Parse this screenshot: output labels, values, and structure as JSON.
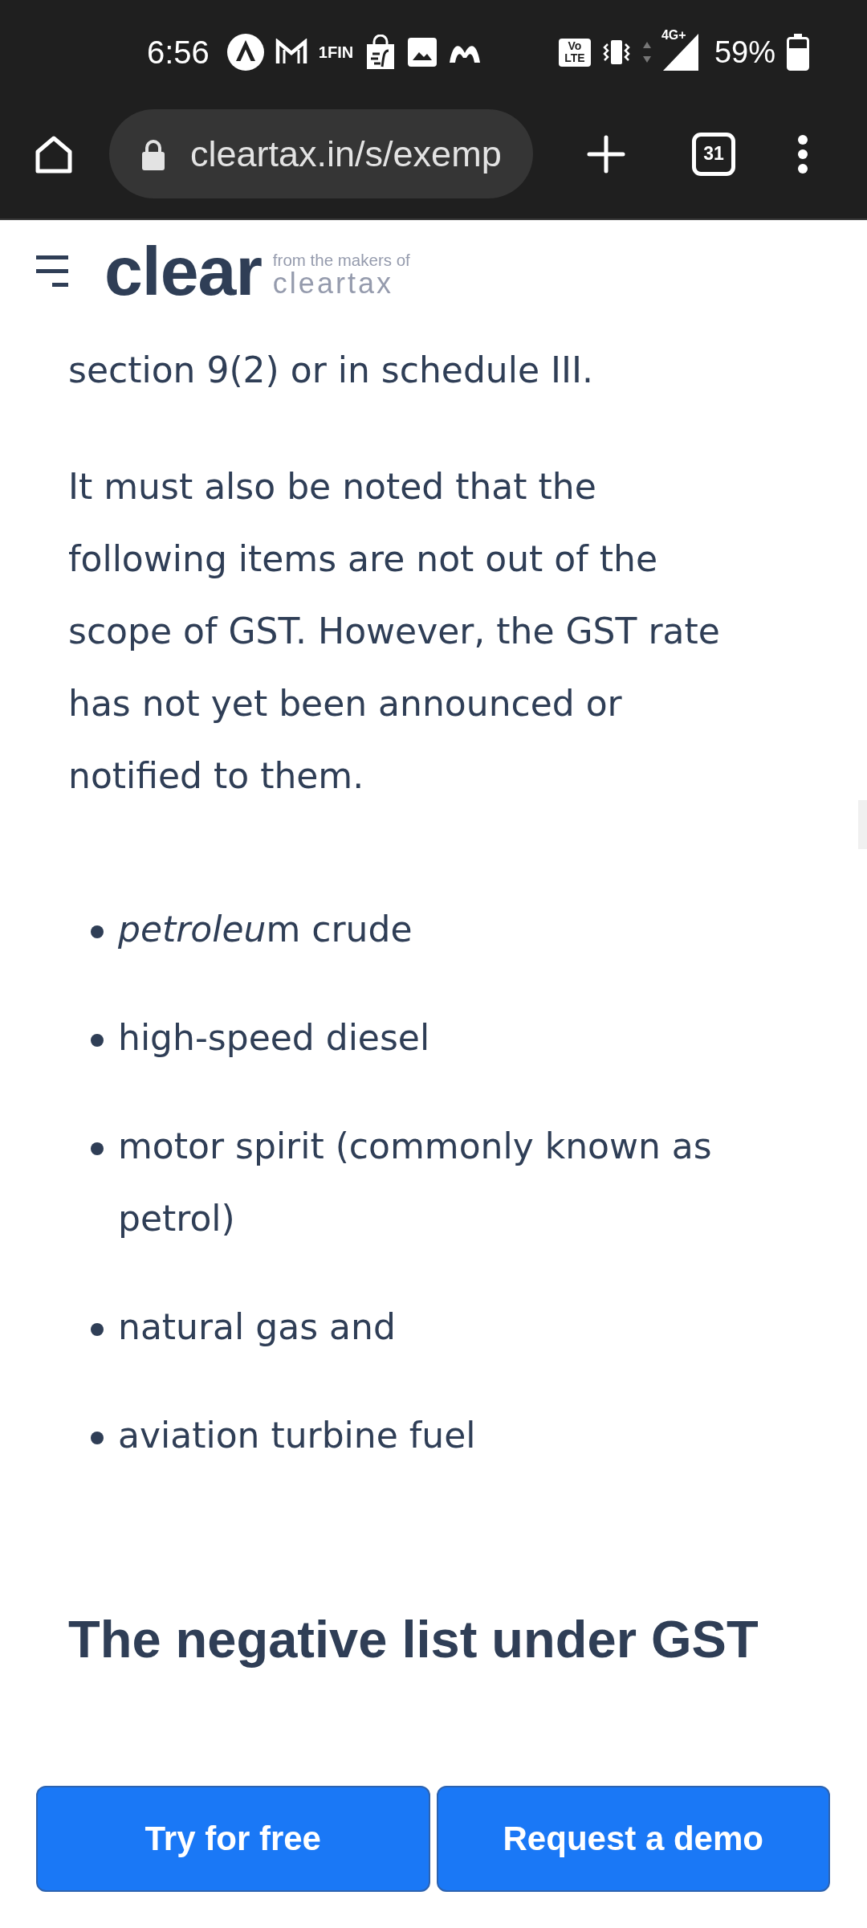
{
  "status_bar": {
    "time": "6:56",
    "notification_label": "1FIN",
    "volte_badge": [
      "Vo",
      "LTE"
    ],
    "network_type": "4G+",
    "battery": "59%"
  },
  "browser_toolbar": {
    "url": "cleartax.in/s/exemp",
    "tab_count": "31"
  },
  "site_header": {
    "logo": "clear",
    "tagline": "from the makers of",
    "brand": "cleartax"
  },
  "article": [
    {
      "kind": "paragraph",
      "text": "section 9(2) or in schedule III."
    },
    {
      "kind": "paragraph",
      "text": "It must also be noted that the following items are not out of the scope of GST. However, the GST rate has not yet been announced or notified to them."
    },
    {
      "kind": "list",
      "items": [
        {
          "parts": [
            {
              "text": "petroleu",
              "italic": true
            },
            {
              "text": "m crude",
              "italic": false
            }
          ]
        },
        {
          "parts": [
            {
              "text": "high-speed diesel",
              "italic": false
            }
          ]
        },
        {
          "parts": [
            {
              "text": "motor spirit (commonly known as petrol)",
              "italic": false
            }
          ]
        },
        {
          "parts": [
            {
              "text": "natural gas and",
              "italic": false
            }
          ]
        },
        {
          "parts": [
            {
              "text": "aviation turbine fuel",
              "italic": false
            }
          ]
        }
      ]
    },
    {
      "kind": "heading",
      "text": "The negative list under GST"
    }
  ],
  "cta_buttons": [
    {
      "label": "Try for free"
    },
    {
      "label": "Request a demo"
    }
  ]
}
